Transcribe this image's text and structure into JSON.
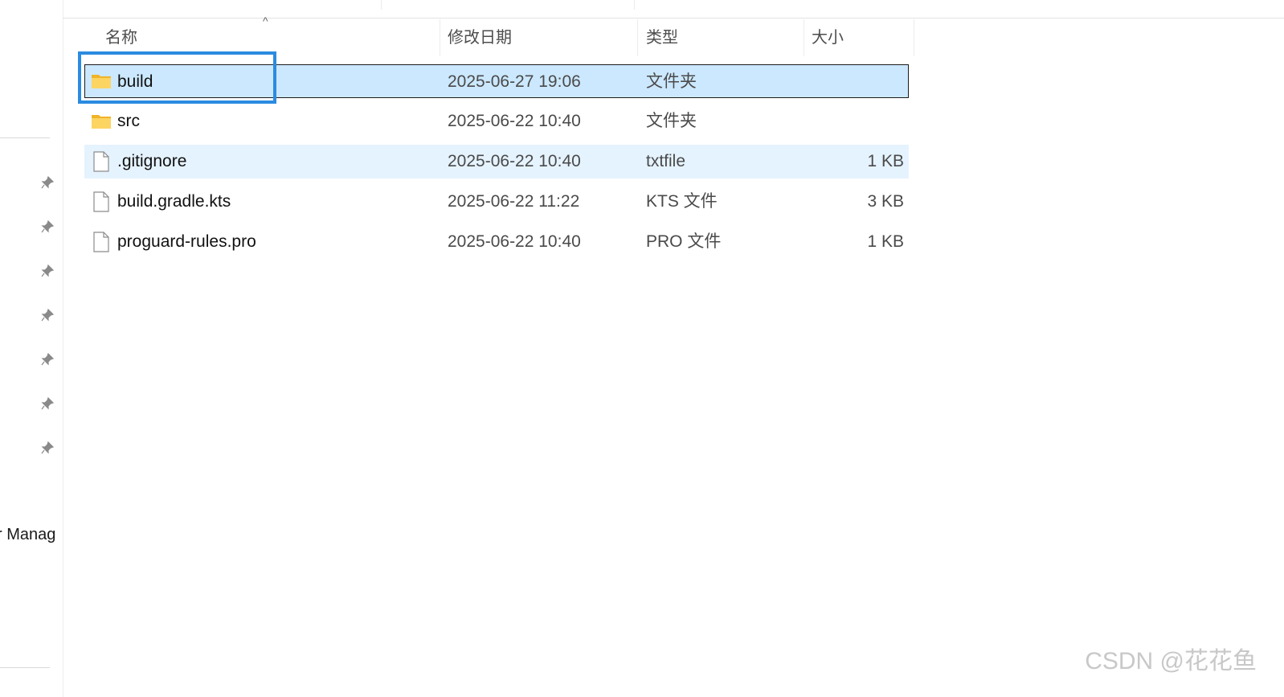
{
  "nav": {
    "partial_label": "r Manag",
    "pinned_count": 7
  },
  "columns": {
    "name": "名称",
    "date": "修改日期",
    "type": "类型",
    "size": "大小",
    "sort_indicator": "^"
  },
  "files": [
    {
      "name": "build",
      "date": "2025-06-27 19:06",
      "type": "文件夹",
      "size": "",
      "icon": "folder-icon",
      "state": "selected"
    },
    {
      "name": "src",
      "date": "2025-06-22 10:40",
      "type": "文件夹",
      "size": "",
      "icon": "folder-icon",
      "state": "normal"
    },
    {
      "name": ".gitignore",
      "date": "2025-06-22 10:40",
      "type": "txtfile",
      "size": "1 KB",
      "icon": "file-icon",
      "state": "hover"
    },
    {
      "name": "build.gradle.kts",
      "date": "2025-06-22 11:22",
      "type": "KTS 文件",
      "size": "3 KB",
      "icon": "file-icon",
      "state": "normal"
    },
    {
      "name": "proguard-rules.pro",
      "date": "2025-06-22 10:40",
      "type": "PRO 文件",
      "size": "1 KB",
      "icon": "file-icon",
      "state": "normal"
    }
  ],
  "colors": {
    "selection_bg": "#cce8ff",
    "hover_bg": "#e5f3ff",
    "highlight_border": "#2b8be0",
    "folder_yellow": "#f8c64b"
  },
  "watermark": "CSDN @花花鱼"
}
